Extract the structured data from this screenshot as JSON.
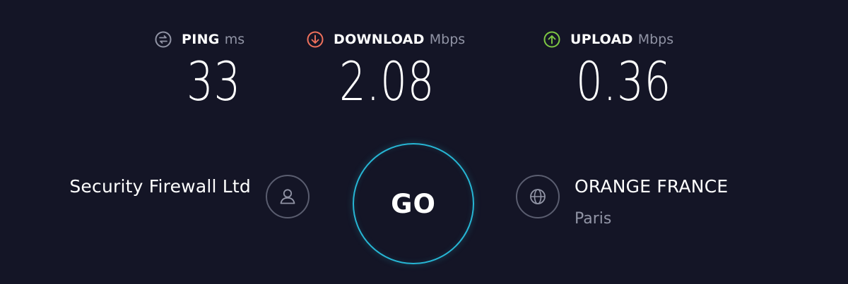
{
  "colors": {
    "background": "#141526",
    "ping_icon": "#9194a5",
    "download_icon": "#f0715c",
    "upload_icon": "#7ec843",
    "go_ring": "#27b6d4",
    "muted_text": "#9194a5"
  },
  "metrics": {
    "ping": {
      "label": "PING",
      "unit": "ms",
      "value": "33",
      "icon": "ping-icon"
    },
    "download": {
      "label": "DOWNLOAD",
      "unit": "Mbps",
      "value": "2.08",
      "icon": "download-arrow-icon"
    },
    "upload": {
      "label": "UPLOAD",
      "unit": "Mbps",
      "value": "0.36",
      "icon": "upload-arrow-icon"
    }
  },
  "isp": {
    "name": "Security Firewall Ltd",
    "icon": "user-icon"
  },
  "go": {
    "label": "GO"
  },
  "server": {
    "name": "ORANGE FRANCE",
    "city": "Paris",
    "icon": "globe-icon"
  }
}
